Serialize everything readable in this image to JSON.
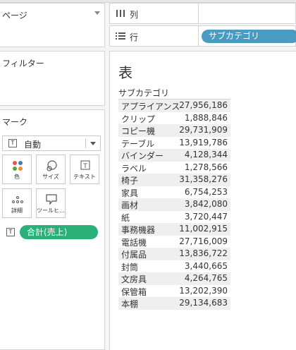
{
  "panels": {
    "pages": {
      "title": "ページ"
    },
    "filters": {
      "title": "フィルター"
    },
    "marks": {
      "title": "マーク",
      "mark_type": "自動",
      "cards": {
        "color": "色",
        "size": "サイズ",
        "text": "テキスト",
        "detail": "詳細",
        "tooltip": "ツールヒ…"
      },
      "text_icon": "T",
      "measure_pill": "合計(売上)"
    }
  },
  "shelves": {
    "columns": {
      "label": "列"
    },
    "rows": {
      "label": "行",
      "pill": "サブカテゴリ"
    }
  },
  "viz": {
    "title": "表",
    "column_header": "サブカテゴリ",
    "rows": [
      {
        "category": "アプライアンス",
        "value": "27,956,186"
      },
      {
        "category": "クリップ",
        "value": "1,888,846"
      },
      {
        "category": "コピー機",
        "value": "29,731,909"
      },
      {
        "category": "テーブル",
        "value": "13,919,786"
      },
      {
        "category": "バインダー",
        "value": "4,128,344"
      },
      {
        "category": "ラベル",
        "value": "1,278,566"
      },
      {
        "category": "椅子",
        "value": "31,358,276"
      },
      {
        "category": "家具",
        "value": "6,754,253"
      },
      {
        "category": "画材",
        "value": "3,842,080"
      },
      {
        "category": "紙",
        "value": "3,720,447"
      },
      {
        "category": "事務機器",
        "value": "11,002,915"
      },
      {
        "category": "電話機",
        "value": "27,716,009"
      },
      {
        "category": "付属品",
        "value": "13,836,722"
      },
      {
        "category": "封筒",
        "value": "3,440,665"
      },
      {
        "category": "文房具",
        "value": "4,264,765"
      },
      {
        "category": "保管箱",
        "value": "13,202,390"
      },
      {
        "category": "本棚",
        "value": "29,134,683"
      }
    ]
  },
  "colors": {
    "dimension_pill": "#4a9bbf",
    "measure_pill": "#2cb07a"
  }
}
